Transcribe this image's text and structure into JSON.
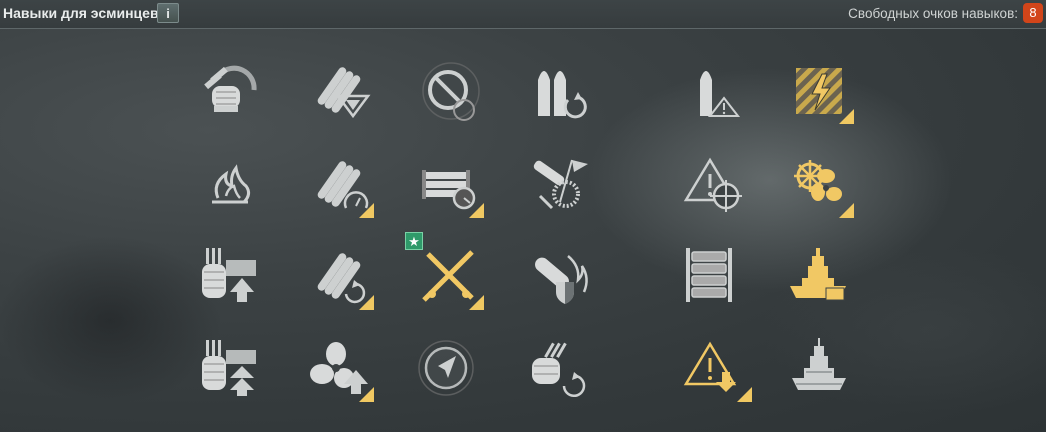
{
  "header": {
    "title": "Навыки для эсминцев",
    "info_label": "i",
    "free_points_label": "Свободных очков навыков:",
    "free_points_value": "8"
  },
  "colors": {
    "skill_inactive": "#cdd0d0",
    "skill_active": "#f1c864",
    "points_badge": "#d2451a",
    "star_badge": "#2f9a6a"
  },
  "skills": [
    {
      "icon": "gun-turret-reload-icon",
      "state": "inactive"
    },
    {
      "icon": "shells-triangle-icon",
      "state": "inactive"
    },
    {
      "icon": "no-entry-sign-icon",
      "state": "inactive"
    },
    {
      "icon": "ammo-reload-icon",
      "state": "inactive"
    },
    {
      "icon": "shell-warning-icon",
      "state": "inactive"
    },
    {
      "icon": "hazard-lightning-icon",
      "state": "active"
    },
    {
      "icon": "fire-icon",
      "state": "inactive"
    },
    {
      "icon": "shells-timer-icon",
      "state": "active-corner"
    },
    {
      "icon": "torpedo-tubes-timer-icon",
      "state": "active-corner"
    },
    {
      "icon": "flag-aa-burst-icon",
      "state": "inactive"
    },
    {
      "icon": "warning-crosshair-icon",
      "state": "inactive"
    },
    {
      "icon": "helm-propellers-icon",
      "state": "active"
    },
    {
      "icon": "turret-upgrade-icon",
      "state": "inactive"
    },
    {
      "icon": "shells-reload-icon",
      "state": "active-corner"
    },
    {
      "icon": "crossed-torpedoes-icon",
      "state": "active",
      "star": "★"
    },
    {
      "icon": "fire-shield-icon",
      "state": "inactive"
    },
    {
      "icon": "torpedo-tubes-icon",
      "state": "inactive"
    },
    {
      "icon": "battleship-upgrade-icon",
      "state": "active"
    },
    {
      "icon": "turret-double-upgrade-icon",
      "state": "inactive"
    },
    {
      "icon": "propeller-upgrade-icon",
      "state": "active-corner"
    },
    {
      "icon": "radar-arrow-icon",
      "state": "inactive"
    },
    {
      "icon": "aa-gun-reload-icon",
      "state": "inactive"
    },
    {
      "icon": "warning-down-icon",
      "state": "active"
    },
    {
      "icon": "battleship-icon",
      "state": "inactive"
    }
  ]
}
